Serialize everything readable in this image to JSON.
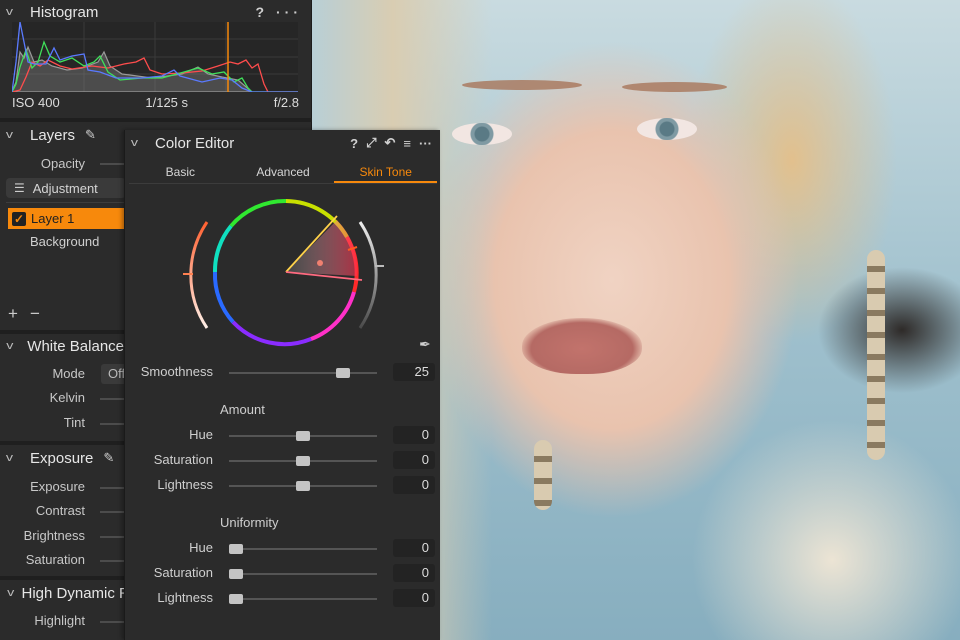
{
  "histogram": {
    "title": "Histogram",
    "help_icon": "?",
    "more_icon": "···",
    "iso": "ISO 400",
    "shutter": "1/125 s",
    "aperture": "f/2.8",
    "colors": {
      "red": "#ff4c4c",
      "green": "#3fe05a",
      "blue": "#5a7aff",
      "luma": "#9a9a9a",
      "marker": "#f7890c"
    }
  },
  "layers": {
    "title": "Layers",
    "opacity_label": "Opacity",
    "adjustment_label": "Adjustment",
    "items": [
      {
        "label": "Layer 1",
        "checked": true,
        "selected": true
      },
      {
        "label": "Background",
        "checked": false,
        "selected": false
      }
    ],
    "add_label": "+",
    "remove_label": "−"
  },
  "white_balance": {
    "title": "White Balance",
    "rows": [
      {
        "label": "Mode",
        "value": "Off"
      },
      {
        "label": "Kelvin"
      },
      {
        "label": "Tint"
      }
    ]
  },
  "exposure": {
    "title": "Exposure",
    "rows": [
      {
        "label": "Exposure"
      },
      {
        "label": "Contrast"
      },
      {
        "label": "Brightness"
      },
      {
        "label": "Saturation"
      }
    ]
  },
  "hdr": {
    "title": "High Dynamic Range",
    "rows": [
      {
        "label": "Highlight"
      }
    ]
  },
  "color_editor": {
    "title": "Color Editor",
    "icons": [
      "?",
      "expand",
      "reset",
      "menu",
      "more"
    ],
    "tabs": [
      {
        "label": "Basic",
        "active": false
      },
      {
        "label": "Advanced",
        "active": false
      },
      {
        "label": "Skin Tone",
        "active": true
      }
    ],
    "accent": "#f7890c",
    "smoothness": {
      "label": "Smoothness",
      "value": "25",
      "fraction": 0.8
    },
    "amount": {
      "title": "Amount",
      "rows": [
        {
          "label": "Hue",
          "value": "0",
          "fraction": 0.5
        },
        {
          "label": "Saturation",
          "value": "0",
          "fraction": 0.5
        },
        {
          "label": "Lightness",
          "value": "0",
          "fraction": 0.5
        }
      ]
    },
    "uniformity": {
      "title": "Uniformity",
      "rows": [
        {
          "label": "Hue",
          "value": "0",
          "fraction": 0.0
        },
        {
          "label": "Saturation",
          "value": "0",
          "fraction": 0.0
        },
        {
          "label": "Lightness",
          "value": "0",
          "fraction": 0.0
        }
      ]
    }
  }
}
